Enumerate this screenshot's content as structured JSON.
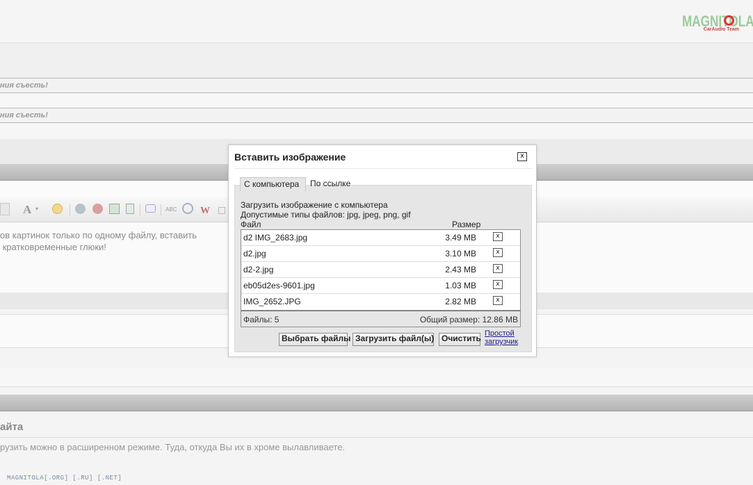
{
  "logo": {
    "main": "MAGNITOLA",
    "sub": "CarAudio Team"
  },
  "background": {
    "field1_text": "ния съесть!",
    "field2_text": "ния съесть!",
    "editor_lines": "ов картинок только по одному файлу, вставить\n кратковременные глюки!",
    "section_title": "айта",
    "bottom_note": "рузить можно в расширенном режиме. Туда, откуда Вы их в хроме вылавливаете.",
    "footer": "MAGNITOLA[.ORG] [.RU] [.NET]"
  },
  "dialog": {
    "title": "Вставить изображение",
    "close_label": "x",
    "tabs": [
      {
        "label": "С компьютера",
        "active": true
      },
      {
        "label": "По ссылке",
        "active": false
      }
    ],
    "upload_line": "Загрузить изображение с компьютера",
    "types_line": "Допустимые типы файлов: jpg, jpeg, png, gif",
    "col_file": "Файл",
    "col_size": "Размер",
    "files": [
      {
        "name": "d2 IMG_2683.jpg",
        "size": "3.49 MB",
        "remove": "x"
      },
      {
        "name": "d2.jpg",
        "size": "3.10 MB",
        "remove": "x"
      },
      {
        "name": "d2-2.jpg",
        "size": "2.43 MB",
        "remove": "x"
      },
      {
        "name": "eb05d2es-9601.jpg",
        "size": "1.03 MB",
        "remove": "x"
      },
      {
        "name": "IMG_2652.JPG",
        "size": "2.82 MB",
        "remove": "x"
      }
    ],
    "files_count": "Файлы: 5",
    "total_size": "Общий размер: 12.86 MB",
    "buttons": {
      "select": "Выбрать файлы",
      "upload": "Загрузить файл(ы)",
      "clear": "Очистить"
    },
    "simple_link_line1": "Простой",
    "simple_link_line2": "загрузчик"
  }
}
